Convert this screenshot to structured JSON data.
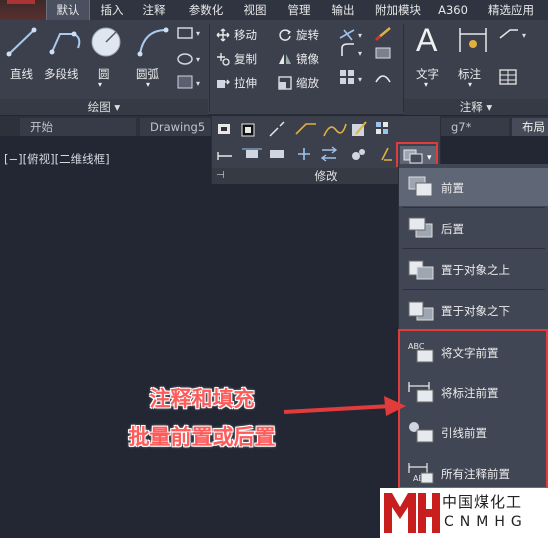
{
  "ribbon_tabs": [
    "默认",
    "插入",
    "注释",
    "参数化",
    "视图",
    "管理",
    "输出",
    "附加模块",
    "A360",
    "精选应用"
  ],
  "ribbon_active_tab": "默认",
  "draw_panel": {
    "tools": [
      "直线",
      "多段线",
      "圆",
      "圆弧"
    ],
    "title": "绘图 ▾"
  },
  "modify_panel": {
    "commands": [
      "移动",
      "旋转",
      "复制",
      "镜像",
      "拉伸",
      "缩放"
    ],
    "title": "修改"
  },
  "annotation_panel": {
    "tools": [
      "文字",
      "标注"
    ],
    "title": "注释 ▾"
  },
  "doc_tabs": [
    "开始",
    "Drawing5",
    "g7*",
    "布局"
  ],
  "viewport_label": "[−][俯视][二维线框]",
  "draworder_menu": {
    "items": [
      "前置",
      "后置",
      "置于对象之上",
      "置于对象之下",
      "将文字前置",
      "将标注前置",
      "引线前置",
      "所有注释前置"
    ],
    "selected_index": 0
  },
  "callout": {
    "line1": "注释和填充",
    "line2": "批量前置或后置"
  },
  "watermark": {
    "cn": "中国煤化工",
    "en": "CNMHG"
  },
  "colors": {
    "accent_red": "#e23b3b",
    "ribbon_bg": "#3b404c",
    "canvas_bg": "#222733"
  }
}
